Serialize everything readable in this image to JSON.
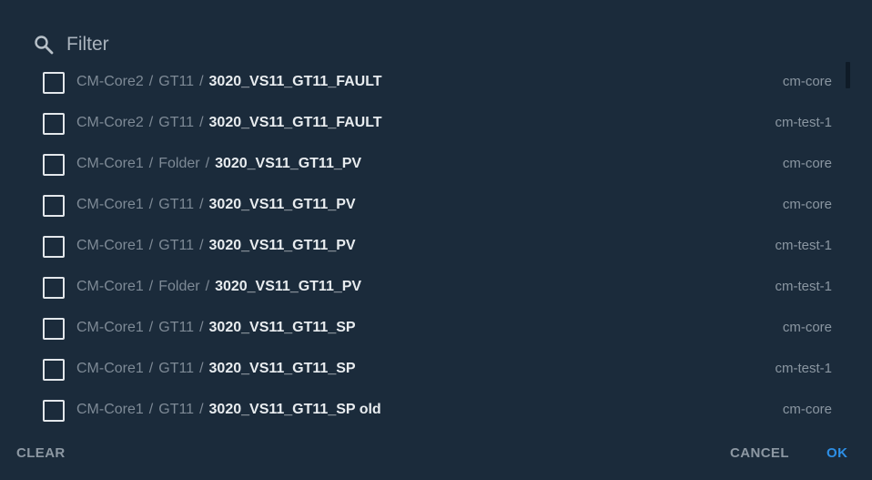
{
  "filter": {
    "placeholder": "Filter",
    "icon": "search-icon"
  },
  "items": [
    {
      "folder": "CM-Core2",
      "group": "GT11",
      "name": "3020_VS11_GT11_FAULT",
      "source": "cm-core",
      "checked": false
    },
    {
      "folder": "CM-Core2",
      "group": "GT11",
      "name": "3020_VS11_GT11_FAULT",
      "source": "cm-test-1",
      "checked": false
    },
    {
      "folder": "CM-Core1",
      "group": "Folder",
      "name": "3020_VS11_GT11_PV",
      "source": "cm-core",
      "checked": false
    },
    {
      "folder": "CM-Core1",
      "group": "GT11",
      "name": "3020_VS11_GT11_PV",
      "source": "cm-core",
      "checked": false
    },
    {
      "folder": "CM-Core1",
      "group": "GT11",
      "name": "3020_VS11_GT11_PV",
      "source": "cm-test-1",
      "checked": false
    },
    {
      "folder": "CM-Core1",
      "group": "Folder",
      "name": "3020_VS11_GT11_PV",
      "source": "cm-test-1",
      "checked": false
    },
    {
      "folder": "CM-Core1",
      "group": "GT11",
      "name": "3020_VS11_GT11_SP",
      "source": "cm-core",
      "checked": false
    },
    {
      "folder": "CM-Core1",
      "group": "GT11",
      "name": "3020_VS11_GT11_SP",
      "source": "cm-test-1",
      "checked": false
    },
    {
      "folder": "CM-Core1",
      "group": "GT11",
      "name": "3020_VS11_GT11_SP old",
      "source": "cm-core",
      "checked": false
    }
  ],
  "separator": "/",
  "actions": {
    "clear": "CLEAR",
    "cancel": "CANCEL",
    "ok": "OK"
  },
  "colors": {
    "background": "#1b2b3b",
    "accent": "#2d8fe6",
    "muted_text": "#7e8a96",
    "primary_text": "#e8ecef"
  }
}
